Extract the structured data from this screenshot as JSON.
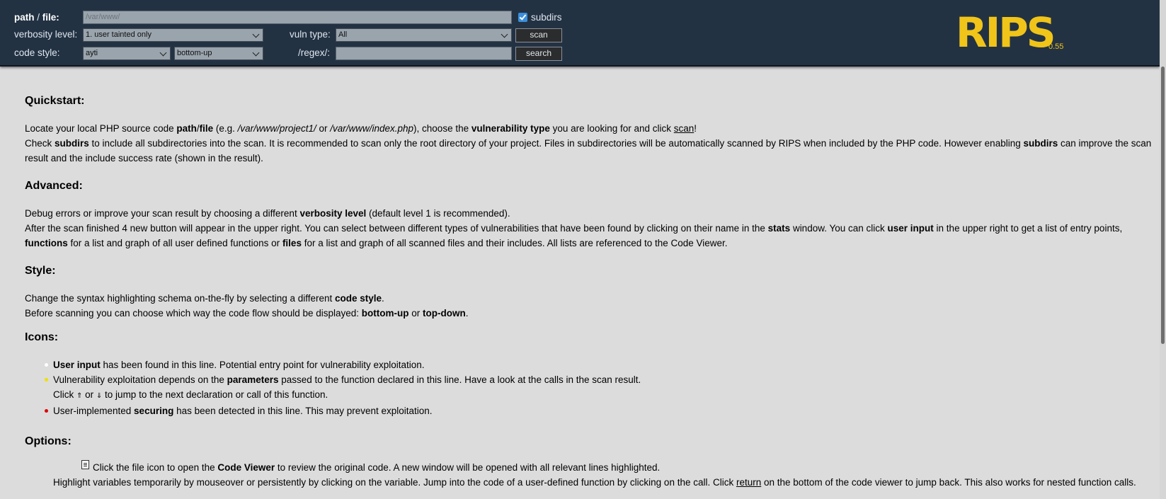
{
  "header": {
    "path_label": "path",
    "path_sep": " / ",
    "file_label": "file:",
    "path_value": "/var/www/",
    "subdirs_label": "subdirs",
    "verbosity_label": "verbosity level:",
    "verbosity_value": "1. user tainted only",
    "vuln_type_label": "vuln type:",
    "vuln_type_value": "All",
    "scan_button": "scan",
    "code_style_label": "code style:",
    "code_style_value": "ayti",
    "flow_value": "bottom-up",
    "regex_label": "/regex/:",
    "regex_value": "",
    "search_button": "search",
    "logo": "RIPS",
    "version": "0.55"
  },
  "quickstart": {
    "title": "Quickstart:",
    "l1_a": "Locate your local PHP source code ",
    "l1_path": "path",
    "l1_sep": "/",
    "l1_file": "file",
    "l1_b": " (e.g. ",
    "l1_ex1": "/var/www/project1/",
    "l1_c": " or ",
    "l1_ex2": "/var/www/index.php",
    "l1_d": "), choose the ",
    "l1_vt": "vulnerability type",
    "l1_e": " you are looking for and click ",
    "l1_scan": "scan",
    "l1_f": "!",
    "l2_a": "Check ",
    "l2_subdirs": "subdirs",
    "l2_b": " to include all subdirectories into the scan. It is recommended to scan only the root directory of your project. Files in subdirectories will be automatically scanned by RIPS when included by the PHP code. However enabling ",
    "l2_subdirs2": "subdirs",
    "l2_c": " can improve the scan result and the include success rate (shown in the result)."
  },
  "advanced": {
    "title": "Advanced:",
    "l1_a": "Debug errors or improve your scan result by choosing a different ",
    "l1_vl": "verbosity level",
    "l1_b": " (default level 1 is recommended).",
    "l2_a": "After the scan finished 4 new button will appear in the upper right. You can select between different types of vulnerabilities that have been found by clicking on their name in the ",
    "l2_stats": "stats",
    "l2_b": " window. You can click ",
    "l2_ui": "user input",
    "l2_c": " in the upper right to get a list of entry points, ",
    "l2_functions": "functions",
    "l2_d": " for a list and graph of all user defined functions or ",
    "l2_files": "files",
    "l2_e": " for a list and graph of all scanned files and their includes. All lists are referenced to the Code Viewer."
  },
  "style": {
    "title": "Style:",
    "l1_a": "Change the syntax highlighting schema on-the-fly by selecting a different ",
    "l1_cs": "code style",
    "l1_b": ".",
    "l2_a": "Before scanning you can choose which way the code flow should be displayed: ",
    "l2_bu": "bottom-up",
    "l2_b": " or ",
    "l2_td": "top-down",
    "l2_c": "."
  },
  "icons": {
    "title": "Icons:",
    "i1_bold": "User input",
    "i1_rest": " has been found in this line. Potential entry point for vulnerability exploitation.",
    "i2_a": "Vulnerability exploitation depends on the ",
    "i2_bold": "parameters",
    "i2_b": " passed to the function declared in this line. Have a look at the calls in the scan result.",
    "i2_c": "Click ",
    "i2_up": "⇑",
    "i2_or": " or ",
    "i2_down": "⇓",
    "i2_d": " to jump to the next declaration or call of this function.",
    "i3_a": "User-implemented ",
    "i3_bold": "securing",
    "i3_b": " has been detected in this line. This may prevent exploitation.",
    "colors": {
      "user_input": "#ffffff",
      "parameters": "#f0e000",
      "securing": "#e00000"
    }
  },
  "options": {
    "title": "Options:",
    "l1_a": "Click the file icon to open the ",
    "l1_cv": "Code Viewer",
    "l1_b": " to review the original code. A new window will be opened with all relevant lines highlighted.",
    "l2_a": "Highlight variables temporarily by mouseover or persistently by clicking on the variable. Jump into the code of a user-defined function by clicking on the call. Click ",
    "l2_return": "return",
    "l2_b": " on the bottom of the code viewer to jump back. This also works for nested function calls."
  }
}
